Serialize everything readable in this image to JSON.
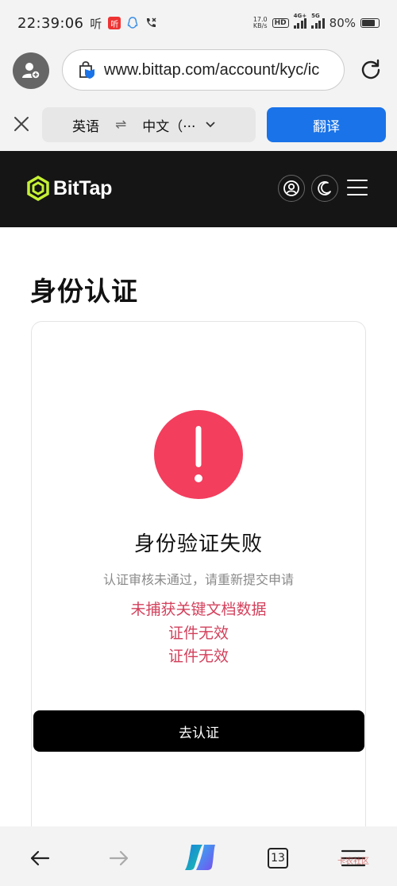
{
  "status_bar": {
    "time": "22:39:06",
    "listen_label": "听",
    "speed_value": "17.0",
    "speed_unit": "KB/s",
    "hd_label": "HD",
    "net1": "4G+",
    "net2": "5G",
    "battery": "80%",
    "battery_level": 0.8
  },
  "browser": {
    "url": "www.bittap.com/account/kyc/ic",
    "translate": {
      "source_lang": "英语",
      "target_lang": "中文（···",
      "button": "翻译"
    },
    "tab_count": "13"
  },
  "site": {
    "brand": "BitTap",
    "brand_color": "#c5f134"
  },
  "page": {
    "title": "身份认证",
    "fail_title": "身份验证失败",
    "fail_subtitle": "认证审核未通过，请重新提交申请",
    "reasons": [
      "未捕获关键文档数据",
      "证件无效",
      "证件无效"
    ],
    "action_button": "去认证"
  },
  "colors": {
    "alert": "#f33e5e",
    "reason_text": "#d3405c",
    "translate_button": "#1a73e8"
  },
  "watermark": "卡农社区"
}
